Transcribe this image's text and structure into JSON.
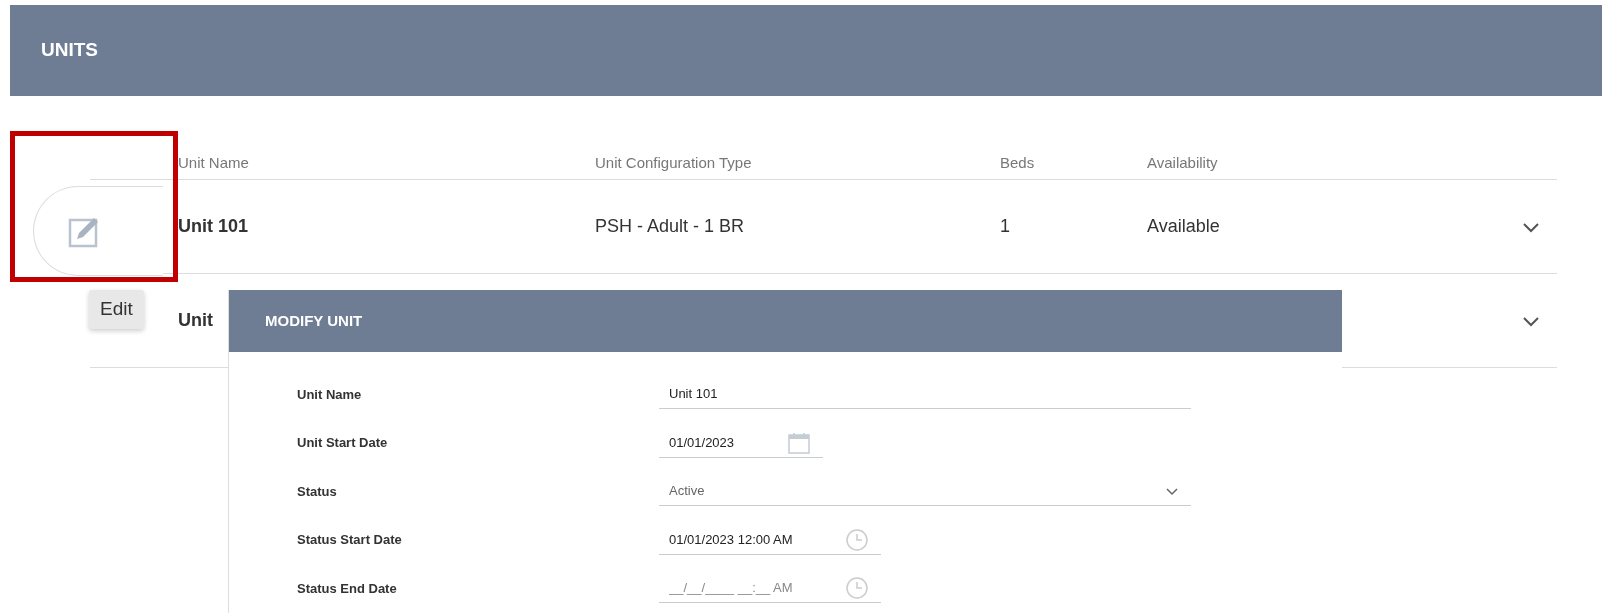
{
  "header": {
    "title": "UNITS"
  },
  "table": {
    "columns": [
      "Unit Name",
      "Unit Configuration Type",
      "Beds",
      "Availability"
    ],
    "rows": [
      {
        "cells": [
          "Unit 101",
          "PSH - Adult - 1 BR",
          "1",
          "Available"
        ]
      },
      {
        "cells": [
          "Unit"
        ]
      }
    ]
  },
  "edit_button": {
    "tooltip": "Edit",
    "highlighted": true
  },
  "modal": {
    "title": "MODIFY UNIT",
    "fields": [
      {
        "label": "Unit Name",
        "kind": "text",
        "value": "Unit 101"
      },
      {
        "label": "Unit Start Date",
        "kind": "date",
        "value": "01/01/2023"
      },
      {
        "label": "Status",
        "kind": "select",
        "value": "Active"
      },
      {
        "label": "Status Start Date",
        "kind": "datetime",
        "value": "01/01/2023 12:00 AM"
      },
      {
        "label": "Status End Date",
        "kind": "datetime",
        "placeholder": "__/__/____ __:__ AM"
      }
    ]
  }
}
